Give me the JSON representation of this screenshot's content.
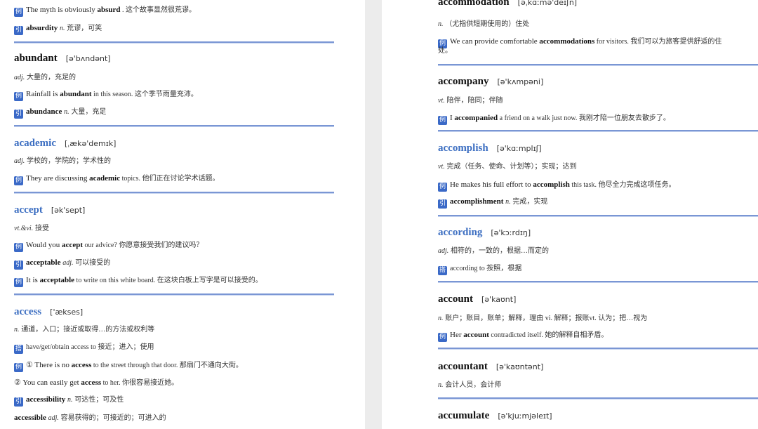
{
  "left": {
    "top_example": {
      "tag": "例",
      "before": "The myth is obviously ",
      "bold": "absurd",
      "after": " . 这个故事显然很荒谬。"
    },
    "top_derived": {
      "tag": "引",
      "bold": "absurdity",
      "pos": "n.",
      "cn": "荒谬，可笑"
    },
    "abundant": {
      "word": "abundant",
      "ipa": "[ə'bʌndənt]",
      "def_pos": "adj.",
      "def": "大量的，充足的",
      "ex_tag": "例",
      "ex_before": "Rainfall is ",
      "ex_bold": "abundant",
      "ex_after": " in this season. 这个季节雨量充沛。",
      "der_tag": "引",
      "der_bold": "abundance",
      "der_pos": "n.",
      "der_cn": "大量，充足"
    },
    "academic": {
      "word": "academic",
      "ipa": "[ˌækə'demɪk]",
      "def_pos": "adj.",
      "def": "学校的，学院的；学术性的",
      "ex_tag": "例",
      "ex_before": "They are discussing ",
      "ex_bold": "academic",
      "ex_after": " topics. 他们正在讨论学术话题。"
    },
    "accept": {
      "word": "accept",
      "ipa": "[ək'sept]",
      "def_pos": "vt.&vi.",
      "def": "接受",
      "ex_tag": "例",
      "ex_before": "Would you ",
      "ex_bold": "accept",
      "ex_after": " our advice? 你愿意接受我们的建议吗？",
      "der_tag": "引",
      "der_bold": "acceptable",
      "der_pos": "adj.",
      "der_cn": "可以接受的",
      "ex2_tag": "例",
      "ex2_before": "It is ",
      "ex2_bold": "acceptable",
      "ex2_after": " to write on this white board. 在这块白板上写字是可以接受的。"
    },
    "access": {
      "word": "access",
      "ipa": "['ækses]",
      "def_pos": "n.",
      "def": "通道，入口；接近或取得…的方法或权利等",
      "col_tag": "搭",
      "col": "have/get/obtain access to 接近；进入；使用",
      "ex_tag": "例",
      "ex_before": "① There is no ",
      "ex_bold": "access",
      "ex_after": " to the street through that door. 那扇门不通向大街。",
      "ex2_before": "② You can easily get ",
      "ex2_bold": "access",
      "ex2_after": " to her. 你很容易接近她。",
      "der_tag": "引",
      "der_bold": "accessibility",
      "der_pos": "n.",
      "der_cn": "可达性；可及性",
      "der2_bold": "accessible",
      "der2_pos": "adj.",
      "der2_cn": "容易获得的；可接近的；可进入的"
    }
  },
  "right": {
    "accommodation": {
      "word": "accommodation",
      "ipa": "[əˌkɑːmə'deɪʃn]",
      "def_pos": "n.",
      "def": "（尤指供短期使用的）住处",
      "ex_tag": "例",
      "ex_before": "We can provide comfortable ",
      "ex_bold": "accommodations",
      "ex_after": " for visitors. 我们可以为旅客提供舒适的住",
      "ex_cont": "处。"
    },
    "accompany": {
      "word": "accompany",
      "ipa": "[ə'kʌmpəni]",
      "def_pos": "vt.",
      "def": "陪伴，陪同；伴随",
      "ex_tag": "例",
      "ex_before": "I ",
      "ex_bold": "accompanied",
      "ex_after": " a friend on a walk just now. 我刚才陪一位朋友去散步了。"
    },
    "accomplish": {
      "word": "accomplish",
      "ipa": "[ə'kɑːmplɪʃ]",
      "def_pos": "vt.",
      "def": "完成（任务、使命、计划等）；实现；达到",
      "ex_tag": "例",
      "ex_before": "He makes his full effort to ",
      "ex_bold": "accomplish",
      "ex_after": " this task. 他尽全力完成这项任务。",
      "der_tag": "引",
      "der_bold": "accomplishment",
      "der_pos": "n.",
      "der_cn": "完成，实现"
    },
    "according": {
      "word": "according",
      "ipa": "[ə'kɔːrdɪŋ]",
      "def_pos": "adj.",
      "def": "相符的，一致的，根据…而定的",
      "col_tag": "搭",
      "col": "according to 按照，根据"
    },
    "account": {
      "word": "account",
      "ipa": "[ə'kaʊnt]",
      "def_pos": "n.",
      "def": "账户；账目，账单；解释，理由 vi. 解释；报账vt. 认为；把…视为",
      "ex_tag": "例",
      "ex_before": "Her ",
      "ex_bold": "account",
      "ex_after": " contradicted itself. 她的解释自相矛盾。"
    },
    "accountant": {
      "word": "accountant",
      "ipa": "[ə'kaʊntənt]",
      "def_pos": "n.",
      "def": "会计人员，会计师"
    },
    "accumulate": {
      "word": "accumulate",
      "ipa": "[ə'kjuːmjəleɪt]"
    }
  },
  "colors": {
    "tag": "#3a69c7",
    "headword_blue": "#3d6fc2",
    "rule": "#7a96d4"
  }
}
